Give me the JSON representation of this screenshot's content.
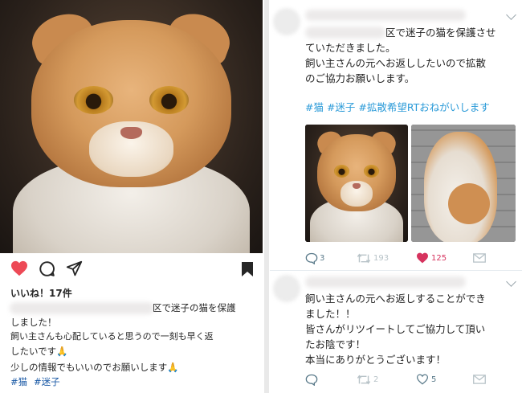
{
  "instagram": {
    "likes_text": "いいね！17件",
    "caption_lines": [
      "区で迷子の猫を保護",
      "しました！",
      "飼い主さんも心配していると思うので一刻も早く返",
      "したいです🙏",
      "少しの情報でもいいのでお願いします🙏"
    ],
    "hashtags": [
      "#猫",
      "#迷子"
    ]
  },
  "tweet1": {
    "text_lines": [
      "区で迷子の猫を保護させ",
      "ていただきました。",
      "飼い主さんの元へお返ししたいので拡散",
      "のご協力お願いします。"
    ],
    "hashtags": "#猫 #迷子 #拡散希望RTおねがいします",
    "reply_count": "3",
    "retweet_count": "193",
    "like_count": "125"
  },
  "tweet2": {
    "text_lines": [
      "飼い主さんの元へお返しすることができ",
      "ました！！",
      "皆さんがリツイートしてご協力して頂い",
      "たお陰です！",
      "本当にありがとうございます！"
    ],
    "retweet_count": "2",
    "like_count": "5"
  },
  "colors": {
    "heart_red": "#ed4956",
    "hashtag_blue": "#1b5aa6",
    "twitter_blue": "#2a9ad8",
    "like_pink": "#d6335e"
  },
  "icons": {
    "instagram_actions": [
      "heart-filled-icon",
      "comment-icon",
      "share-icon",
      "bookmark-icon"
    ],
    "twitter_actions": [
      "reply-icon",
      "retweet-icon",
      "like-icon",
      "mail-icon"
    ]
  }
}
